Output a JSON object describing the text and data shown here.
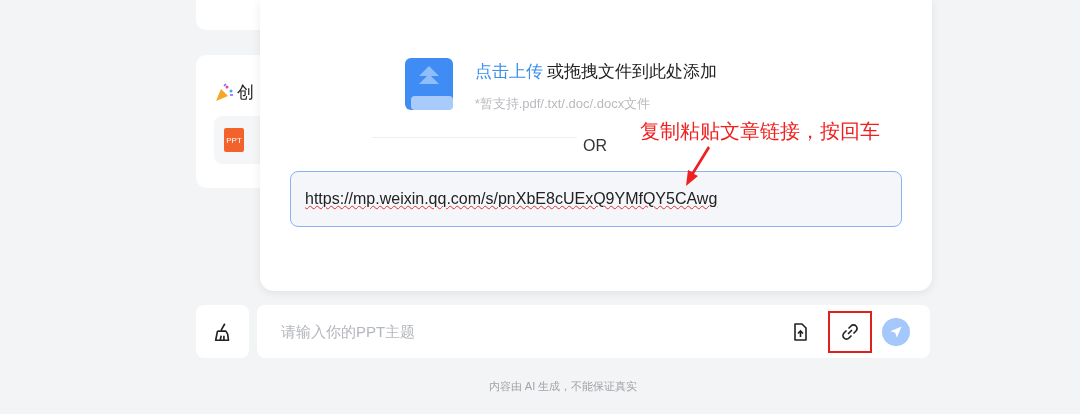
{
  "background_card": {
    "title": "创",
    "file_badge": "PPT"
  },
  "upload_dialog": {
    "upload_link": "点击上传",
    "upload_text": "或拖拽文件到此处添加",
    "hint": "*暂支持.pdf/.txt/.doc/.docx文件",
    "divider_text": "OR",
    "link_field": {
      "value": "https://mp.weixin.qq.com/s/pnXbE8cUExQ9YMfQY5CAwg"
    }
  },
  "annotation": {
    "text": "复制粘贴文章链接，按回车"
  },
  "input_bar": {
    "placeholder": "请输入你的PPT主题",
    "link_highlighted": true
  },
  "footer": "内容由 AI 生成，不能保证真实"
}
